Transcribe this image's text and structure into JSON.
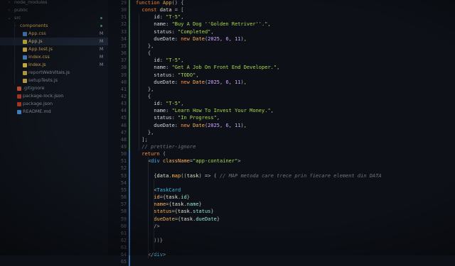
{
  "explorer": {
    "items": [
      {
        "name": "node_modules",
        "type": "folder",
        "indent": 1,
        "chevron": "›",
        "color": "#7f8797"
      },
      {
        "name": "public",
        "type": "folder",
        "indent": 1,
        "chevron": "›",
        "color": "#7f8797"
      },
      {
        "name": "src",
        "type": "folder",
        "indent": 1,
        "chevron": "⌄",
        "color": "#7f8797",
        "dot": true
      },
      {
        "name": "components",
        "type": "folder",
        "indent": 2,
        "chevron": "›",
        "color": "#e7b45a",
        "dot": true
      },
      {
        "name": "App.css",
        "type": "css",
        "indent": 2,
        "color": "#d6a85e",
        "badge": "M",
        "icon_color": "#4f8fd6"
      },
      {
        "name": "App.js",
        "type": "js",
        "indent": 2,
        "color": "#d6c67a",
        "badge": "M",
        "icon_color": "#e5c849",
        "selected": true
      },
      {
        "name": "App.test.js",
        "type": "js",
        "indent": 2,
        "color": "#d6a85e",
        "badge": "M",
        "icon_color": "#e5c849"
      },
      {
        "name": "index.css",
        "type": "css",
        "indent": 2,
        "color": "#d6a85e",
        "badge": "M",
        "icon_color": "#4f8fd6"
      },
      {
        "name": "index.js",
        "type": "js",
        "indent": 2,
        "color": "#d6a85e",
        "badge": "M",
        "icon_color": "#e5c849"
      },
      {
        "name": "reportWebVitals.js",
        "type": "js",
        "indent": 2,
        "color": "#7f8797",
        "icon_color": "#c6b04a"
      },
      {
        "name": "setupTests.js",
        "type": "js",
        "indent": 2,
        "color": "#7f8797",
        "icon_color": "#c6b04a"
      },
      {
        "name": ".gitignore",
        "type": "git",
        "indent": 1,
        "color": "#7f8797",
        "icon_color": "#d3573b"
      },
      {
        "name": "package-lock.json",
        "type": "json",
        "indent": 1,
        "color": "#7f8797",
        "icon_color": "#c0392b"
      },
      {
        "name": "package.json",
        "type": "json",
        "indent": 1,
        "color": "#7f8797",
        "icon_color": "#c0392b"
      },
      {
        "name": "README.md",
        "type": "md",
        "indent": 1,
        "color": "#7f8797",
        "icon_color": "#4a8fd6"
      }
    ]
  },
  "gutter": {
    "line_numbers": [
      "29",
      "30",
      "31",
      "32",
      "33",
      "34",
      "35",
      "36",
      "37",
      "38",
      "39",
      "40",
      "41",
      "42",
      "43",
      "44",
      "45",
      "46",
      "47",
      "48",
      "49",
      "50",
      "51",
      "52",
      "53",
      "54",
      "55",
      "56",
      "57",
      "58",
      "59",
      "60",
      "61",
      "62",
      "63",
      "64",
      "65"
    ]
  },
  "code": {
    "lines": [
      [
        {
          "t": "function ",
          "c": "kw"
        },
        {
          "t": "App",
          "c": "fn"
        },
        {
          "t": "() {",
          "c": "punc"
        }
      ],
      [
        {
          "t": "  const ",
          "c": "kw"
        },
        {
          "t": "data",
          "c": "var"
        },
        {
          "t": " = [",
          "c": "punc"
        }
      ],
      [
        {
          "t": "      id: ",
          "c": "prop"
        },
        {
          "t": "\"T-5\"",
          "c": "str"
        },
        {
          "t": ",",
          "c": "punc"
        }
      ],
      [
        {
          "t": "      name: ",
          "c": "prop"
        },
        {
          "t": "\"Buy A Dog ''Golden Retriver''.\"",
          "c": "str"
        },
        {
          "t": ",",
          "c": "punc"
        }
      ],
      [
        {
          "t": "      status: ",
          "c": "prop"
        },
        {
          "t": "\"Completed\"",
          "c": "str"
        },
        {
          "t": ",",
          "c": "punc"
        }
      ],
      [
        {
          "t": "      dueDate: ",
          "c": "prop"
        },
        {
          "t": "new ",
          "c": "kw"
        },
        {
          "t": "Date",
          "c": "fn"
        },
        {
          "t": "(",
          "c": "punc"
        },
        {
          "t": "2025",
          "c": "num"
        },
        {
          "t": ", ",
          "c": "punc"
        },
        {
          "t": "6",
          "c": "num"
        },
        {
          "t": ", ",
          "c": "punc"
        },
        {
          "t": "11",
          "c": "num"
        },
        {
          "t": "),",
          "c": "punc"
        }
      ],
      [
        {
          "t": "    },",
          "c": "punc"
        }
      ],
      [
        {
          "t": "    {",
          "c": "punc"
        }
      ],
      [
        {
          "t": "      id: ",
          "c": "prop"
        },
        {
          "t": "\"T-5\"",
          "c": "str"
        },
        {
          "t": ",",
          "c": "punc"
        }
      ],
      [
        {
          "t": "      name: ",
          "c": "prop"
        },
        {
          "t": "\"Get A Job On Front End Developer.\"",
          "c": "str"
        },
        {
          "t": ",",
          "c": "punc"
        }
      ],
      [
        {
          "t": "      status: ",
          "c": "prop"
        },
        {
          "t": "\"TODO\"",
          "c": "str"
        },
        {
          "t": ",",
          "c": "punc"
        }
      ],
      [
        {
          "t": "      dueDate: ",
          "c": "prop"
        },
        {
          "t": "new ",
          "c": "kw"
        },
        {
          "t": "Date",
          "c": "fn"
        },
        {
          "t": "(",
          "c": "punc"
        },
        {
          "t": "2025",
          "c": "num"
        },
        {
          "t": ", ",
          "c": "punc"
        },
        {
          "t": "6",
          "c": "num"
        },
        {
          "t": ", ",
          "c": "punc"
        },
        {
          "t": "11",
          "c": "num"
        },
        {
          "t": "),",
          "c": "punc"
        }
      ],
      [
        {
          "t": "    },",
          "c": "punc"
        }
      ],
      [
        {
          "t": "    {",
          "c": "punc"
        }
      ],
      [
        {
          "t": "      id: ",
          "c": "prop"
        },
        {
          "t": "\"T-5\"",
          "c": "str"
        },
        {
          "t": ",",
          "c": "punc"
        }
      ],
      [
        {
          "t": "      name: ",
          "c": "prop"
        },
        {
          "t": "\"Learn How To Invest Your Money.\"",
          "c": "str"
        },
        {
          "t": ",",
          "c": "punc"
        }
      ],
      [
        {
          "t": "      status: ",
          "c": "prop"
        },
        {
          "t": "\"In Progress\"",
          "c": "str"
        },
        {
          "t": ",",
          "c": "punc"
        }
      ],
      [
        {
          "t": "      dueDate: ",
          "c": "prop"
        },
        {
          "t": "new ",
          "c": "kw"
        },
        {
          "t": "Date",
          "c": "fn"
        },
        {
          "t": "(",
          "c": "punc"
        },
        {
          "t": "2025",
          "c": "num"
        },
        {
          "t": ", ",
          "c": "punc"
        },
        {
          "t": "6",
          "c": "num"
        },
        {
          "t": ", ",
          "c": "punc"
        },
        {
          "t": "11",
          "c": "num"
        },
        {
          "t": "),",
          "c": "punc"
        }
      ],
      [
        {
          "t": "    },",
          "c": "punc"
        }
      ],
      [
        {
          "t": "  ];",
          "c": "punc"
        }
      ],
      [
        {
          "t": "  // prettier-ignore",
          "c": "cm"
        }
      ],
      [
        {
          "t": "  return ",
          "c": "kw"
        },
        {
          "t": "(",
          "c": "punc"
        }
      ],
      [
        {
          "t": "    <",
          "c": "punc"
        },
        {
          "t": "div ",
          "c": "tag"
        },
        {
          "t": "className",
          "c": "attr"
        },
        {
          "t": "=",
          "c": "punc"
        },
        {
          "t": "\"app-container\"",
          "c": "str"
        },
        {
          "t": ">",
          "c": "punc"
        }
      ],
      [
        {
          "t": "",
          "c": "punc"
        }
      ],
      [
        {
          "t": "      {",
          "c": "punc"
        },
        {
          "t": "data",
          "c": "var"
        },
        {
          "t": ".",
          "c": "punc"
        },
        {
          "t": "map",
          "c": "fn"
        },
        {
          "t": "((",
          "c": "punc"
        },
        {
          "t": "task",
          "c": "var"
        },
        {
          "t": ") => ( ",
          "c": "punc"
        },
        {
          "t": "// MAP metoda care trece prin fiecare element din DATA",
          "c": "cm"
        }
      ],
      [
        {
          "t": "",
          "c": "punc"
        }
      ],
      [
        {
          "t": "      <",
          "c": "punc"
        },
        {
          "t": "TaskCard",
          "c": "tag"
        }
      ],
      [
        {
          "t": "      ",
          "c": "punc"
        },
        {
          "t": "id",
          "c": "attr"
        },
        {
          "t": "={",
          "c": "punc"
        },
        {
          "t": "task",
          "c": "var"
        },
        {
          "t": ".",
          "c": "punc"
        },
        {
          "t": "id",
          "c": "jsx"
        },
        {
          "t": "}",
          "c": "punc"
        }
      ],
      [
        {
          "t": "      ",
          "c": "punc"
        },
        {
          "t": "name",
          "c": "attr"
        },
        {
          "t": "={",
          "c": "punc"
        },
        {
          "t": "task",
          "c": "var"
        },
        {
          "t": ".",
          "c": "punc"
        },
        {
          "t": "name",
          "c": "jsx"
        },
        {
          "t": "}",
          "c": "punc"
        }
      ],
      [
        {
          "t": "      ",
          "c": "punc"
        },
        {
          "t": "status",
          "c": "attr"
        },
        {
          "t": "={",
          "c": "punc"
        },
        {
          "t": "task",
          "c": "var"
        },
        {
          "t": ".",
          "c": "punc"
        },
        {
          "t": "status",
          "c": "jsx"
        },
        {
          "t": "}",
          "c": "punc"
        }
      ],
      [
        {
          "t": "      ",
          "c": "punc"
        },
        {
          "t": "dueDate",
          "c": "attr"
        },
        {
          "t": "={",
          "c": "punc"
        },
        {
          "t": "task",
          "c": "var"
        },
        {
          "t": ".",
          "c": "punc"
        },
        {
          "t": "dueDate",
          "c": "jsx"
        },
        {
          "t": "}",
          "c": "punc"
        }
      ],
      [
        {
          "t": "      />",
          "c": "punc"
        }
      ],
      [
        {
          "t": "",
          "c": "punc"
        }
      ],
      [
        {
          "t": "      ))}",
          "c": "punc"
        }
      ],
      [
        {
          "t": "",
          "c": "punc"
        }
      ],
      [
        {
          "t": "    </",
          "c": "punc"
        },
        {
          "t": "div",
          "c": "tag"
        },
        {
          "t": ">",
          "c": "punc"
        }
      ],
      [
        {
          "t": "",
          "c": "punc"
        }
      ]
    ]
  },
  "theme": {
    "git_added_color": "#3f7a57",
    "git_modified_color": "#3d6fa8"
  }
}
